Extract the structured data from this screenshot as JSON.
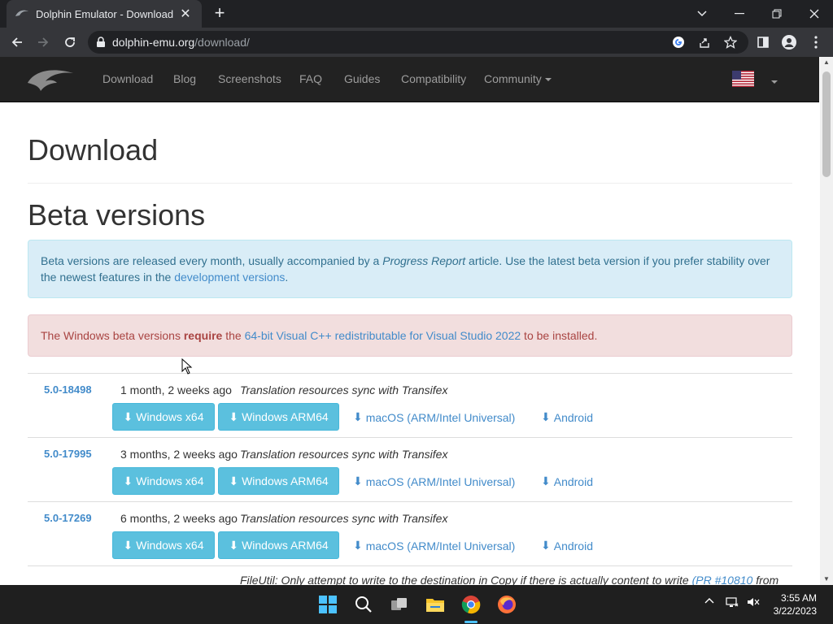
{
  "browser": {
    "tab_title": "Dolphin Emulator - Download",
    "url_host": "dolphin-emu.org",
    "url_path": "/download/"
  },
  "site_nav": {
    "items": [
      "Download",
      "Blog",
      "Screenshots",
      "FAQ",
      "Guides",
      "Compatibility",
      "Community"
    ]
  },
  "page": {
    "title": "Download",
    "section_title": "Beta versions",
    "info_alert": {
      "text_1": "Beta versions are released every month, usually accompanied by a ",
      "text_em": "Progress Report",
      "text_2": " article. Use the latest beta version if you prefer stability over the newest features in the ",
      "link": "development versions",
      "text_3": "."
    },
    "danger_alert": {
      "text_1": "The Windows beta versions ",
      "text_bold": "require",
      "text_2": " the ",
      "link": "64-bit Visual C++ redistributable for Visual Studio 2022",
      "text_3": " to be installed."
    },
    "versions": [
      {
        "version": "5.0-18498",
        "age": "1 month, 2 weeks ago",
        "message": "Translation resources sync with Transifex"
      },
      {
        "version": "5.0-17995",
        "age": "3 months, 2 weeks ago",
        "message": "Translation resources sync with Transifex"
      },
      {
        "version": "5.0-17269",
        "age": "6 months, 2 weeks ago",
        "message": "Translation resources sync with Transifex"
      }
    ],
    "downloads": {
      "win_x64": "Windows x64",
      "win_arm64": "Windows ARM64",
      "macos": "macOS (ARM/Intel Universal)",
      "android": "Android"
    },
    "cut_text_1": "FileUtil: Only attempt to write to the destination in Copy if there is actually content to write ",
    "cut_link": "(PR #10810",
    "cut_text_2": " from"
  },
  "taskbar": {
    "time": "3:55 AM",
    "date": "3/22/2023"
  },
  "colors": {
    "link": "#428bca",
    "info_bg": "#d9edf7",
    "danger_bg": "#f2dede",
    "button": "#5bc0de"
  }
}
